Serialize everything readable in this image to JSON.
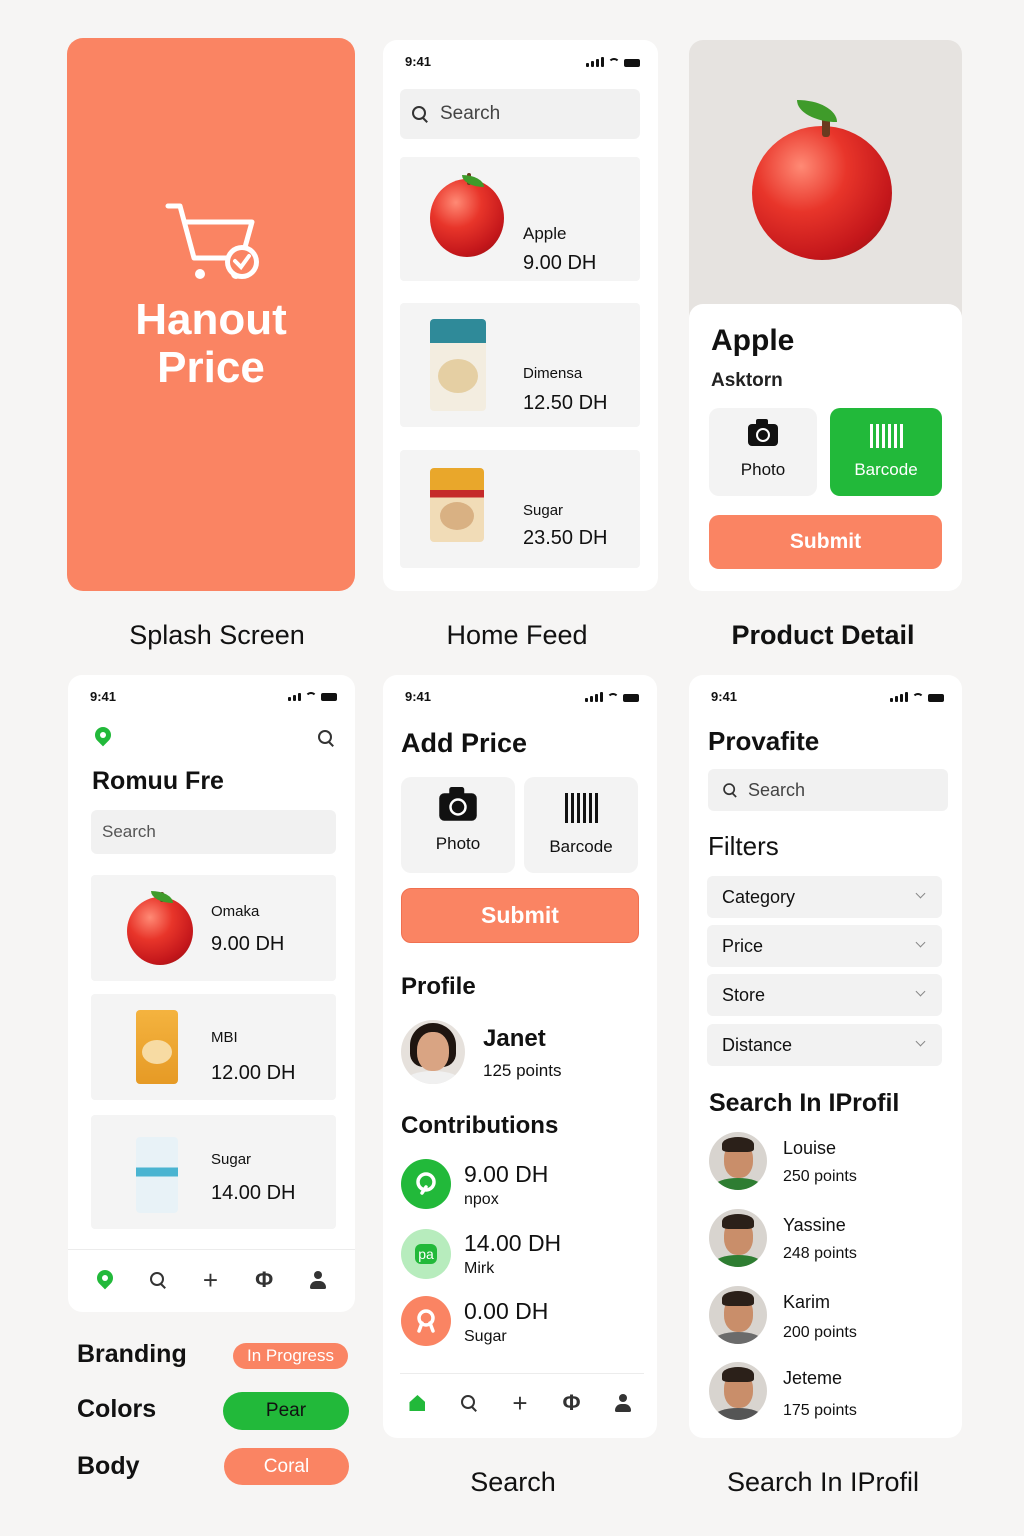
{
  "splash": {
    "brand_line1": "Hanout",
    "brand_line2": "Price",
    "caption": "Splash Screen",
    "bg_color": "#fa8463",
    "icon": "cart-check-icon"
  },
  "status": {
    "time": "9:41"
  },
  "home_feed": {
    "caption": "Home Feed",
    "search_placeholder": "Search",
    "items": [
      {
        "name": "Apple",
        "price": "9.00 DH"
      },
      {
        "name": "Dimensa",
        "price": "12.50 DH"
      },
      {
        "name": "Sugar",
        "price": "23.50 DH"
      }
    ]
  },
  "product_detail": {
    "caption": "Product Detail",
    "title": "Apple",
    "store": "Asktorn",
    "photo_label": "Photo",
    "barcode_label": "Barcode",
    "submit_label": "Submit"
  },
  "feed2": {
    "store_name": "Romuu Fre",
    "search_placeholder": "Search",
    "items": [
      {
        "name": "Omaka",
        "price": "9.00 DH"
      },
      {
        "name": "MBI",
        "price": "12.00 DH"
      },
      {
        "name": "Sugar",
        "price": "14.00 DH"
      }
    ]
  },
  "add_price": {
    "caption": "Search",
    "title": "Add Price",
    "photo_label": "Photo",
    "barcode_label": "Barcode",
    "submit_label": "Submit",
    "profile_heading": "Profile",
    "profile_name": "Janet",
    "profile_points": "125 points",
    "contributions_heading": "Contributions",
    "contributions": [
      {
        "price": "9.00 DH",
        "label": "npox",
        "icon_text": ""
      },
      {
        "price": "14.00 DH",
        "label": "Mirk",
        "icon_text": "pa"
      },
      {
        "price": "0.00 DH",
        "label": "Sugar",
        "icon_text": ""
      }
    ]
  },
  "profile_search": {
    "caption": "Search In IProfil",
    "title": "Provafite",
    "search_placeholder": "Search",
    "filters_heading": "Filters",
    "filters": [
      "Category",
      "Price",
      "Store",
      "Distance"
    ],
    "people_heading": "Search In IProfil",
    "people": [
      {
        "name": "Louise",
        "points": "250 points"
      },
      {
        "name": "Yassine",
        "points": "248 points"
      },
      {
        "name": "Karim",
        "points": "200 points"
      },
      {
        "name": "Jeteme",
        "points": "175 points"
      }
    ]
  },
  "style_guide": {
    "rows": [
      {
        "label": "Branding",
        "tag": "In Progress"
      },
      {
        "label": "Colors",
        "tag": "Pear"
      },
      {
        "label": "Body",
        "tag": "Coral"
      }
    ],
    "colors": {
      "coral": "#fa8463",
      "green": "#22b93a"
    }
  }
}
